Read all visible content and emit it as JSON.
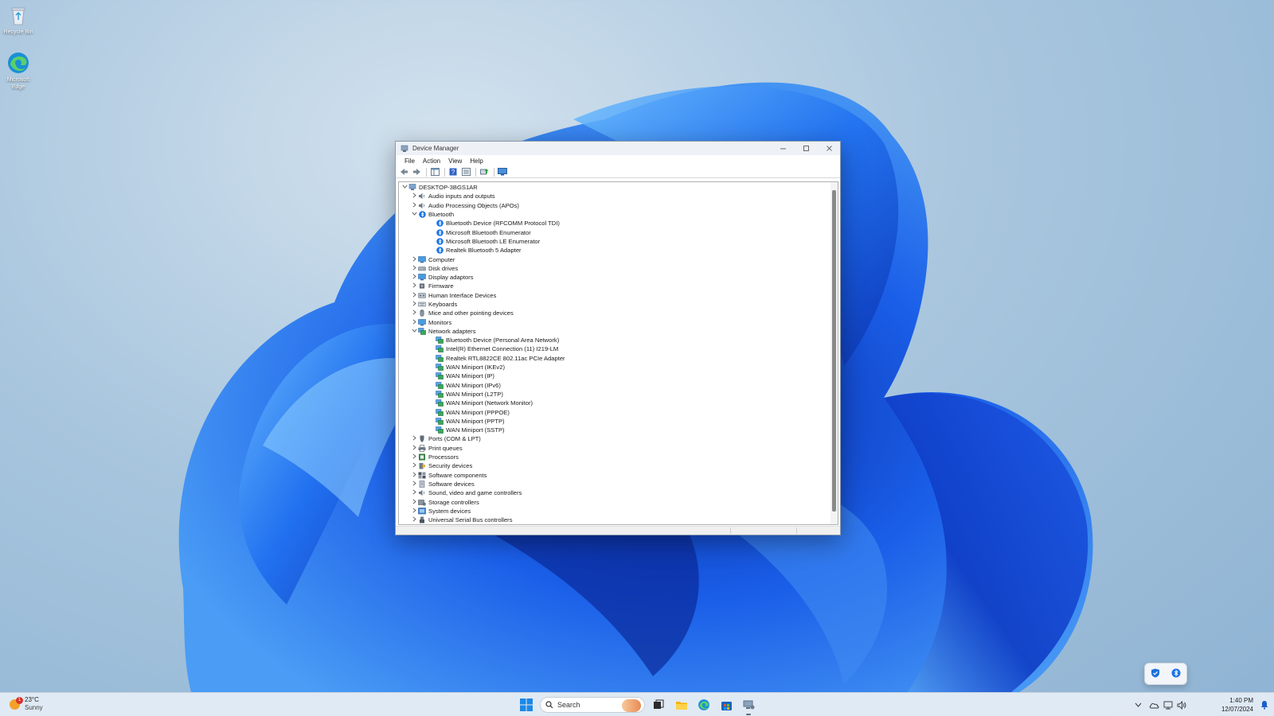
{
  "desktop": {
    "icons": [
      {
        "label": "Recycle Bin",
        "icon": "recycle-bin-icon"
      },
      {
        "label": "Microsoft Edge",
        "icon": "edge-icon"
      }
    ]
  },
  "window": {
    "title": "Device Manager",
    "menu": [
      "File",
      "Action",
      "View",
      "Help"
    ],
    "toolbar_icons": [
      "back-arrow-icon",
      "forward-arrow-icon",
      "show-hide-console-tree-icon",
      "help-icon",
      "properties-icon",
      "update-driver-icon",
      "scan-hardware-changes-icon"
    ],
    "tree": [
      {
        "level": 0,
        "expander": "v",
        "label": "DESKTOP-3BGS1AR",
        "icon": "computer-root-icon"
      },
      {
        "level": 1,
        "expander": ">",
        "label": "Audio inputs and outputs",
        "icon": "audio-icon"
      },
      {
        "level": 1,
        "expander": ">",
        "label": "Audio Processing Objects (APOs)",
        "icon": "audio-icon"
      },
      {
        "level": 1,
        "expander": "v",
        "label": "Bluetooth",
        "icon": "bluetooth-icon"
      },
      {
        "level": 2,
        "expander": "",
        "label": "Bluetooth Device (RFCOMM Protocol TDI)",
        "icon": "bluetooth-icon"
      },
      {
        "level": 2,
        "expander": "",
        "label": "Microsoft Bluetooth Enumerator",
        "icon": "bluetooth-icon"
      },
      {
        "level": 2,
        "expander": "",
        "label": "Microsoft Bluetooth LE Enumerator",
        "icon": "bluetooth-icon"
      },
      {
        "level": 2,
        "expander": "",
        "label": "Realtek Bluetooth 5 Adapter",
        "icon": "bluetooth-icon"
      },
      {
        "level": 1,
        "expander": ">",
        "label": "Computer",
        "icon": "monitor-icon"
      },
      {
        "level": 1,
        "expander": ">",
        "label": "Disk drives",
        "icon": "disk-icon"
      },
      {
        "level": 1,
        "expander": ">",
        "label": "Display adaptors",
        "icon": "monitor-icon"
      },
      {
        "level": 1,
        "expander": ">",
        "label": "Firmware",
        "icon": "chip-icon"
      },
      {
        "level": 1,
        "expander": ">",
        "label": "Human Interface Devices",
        "icon": "hid-icon"
      },
      {
        "level": 1,
        "expander": ">",
        "label": "Keyboards",
        "icon": "keyboard-icon"
      },
      {
        "level": 1,
        "expander": ">",
        "label": "Mice and other pointing devices",
        "icon": "mouse-icon"
      },
      {
        "level": 1,
        "expander": ">",
        "label": "Monitors",
        "icon": "monitor-icon"
      },
      {
        "level": 1,
        "expander": "v",
        "label": "Network adapters",
        "icon": "network-icon"
      },
      {
        "level": 2,
        "expander": "",
        "label": "Bluetooth Device (Personal Area Network)",
        "icon": "network-icon"
      },
      {
        "level": 2,
        "expander": "",
        "label": "Intel(R) Ethernet Connection (11) I219-LM",
        "icon": "network-icon"
      },
      {
        "level": 2,
        "expander": "",
        "label": "Realtek RTL8822CE 802.11ac PCIe Adapter",
        "icon": "network-icon"
      },
      {
        "level": 2,
        "expander": "",
        "label": "WAN Miniport (IKEv2)",
        "icon": "network-icon"
      },
      {
        "level": 2,
        "expander": "",
        "label": "WAN Miniport (IP)",
        "icon": "network-icon"
      },
      {
        "level": 2,
        "expander": "",
        "label": "WAN Miniport (IPv6)",
        "icon": "network-icon"
      },
      {
        "level": 2,
        "expander": "",
        "label": "WAN Miniport (L2TP)",
        "icon": "network-icon"
      },
      {
        "level": 2,
        "expander": "",
        "label": "WAN Miniport (Network Monitor)",
        "icon": "network-icon"
      },
      {
        "level": 2,
        "expander": "",
        "label": "WAN Miniport (PPPOE)",
        "icon": "network-icon"
      },
      {
        "level": 2,
        "expander": "",
        "label": "WAN Miniport (PPTP)",
        "icon": "network-icon"
      },
      {
        "level": 2,
        "expander": "",
        "label": "WAN Miniport (SSTP)",
        "icon": "network-icon"
      },
      {
        "level": 1,
        "expander": ">",
        "label": "Ports (COM & LPT)",
        "icon": "port-icon"
      },
      {
        "level": 1,
        "expander": ">",
        "label": "Print queues",
        "icon": "printer-icon"
      },
      {
        "level": 1,
        "expander": ">",
        "label": "Processors",
        "icon": "processor-icon"
      },
      {
        "level": 1,
        "expander": ">",
        "label": "Security devices",
        "icon": "security-icon"
      },
      {
        "level": 1,
        "expander": ">",
        "label": "Software components",
        "icon": "software-icon"
      },
      {
        "level": 1,
        "expander": ">",
        "label": "Software devices",
        "icon": "software-device-icon"
      },
      {
        "level": 1,
        "expander": ">",
        "label": "Sound, video and game controllers",
        "icon": "audio-icon"
      },
      {
        "level": 1,
        "expander": ">",
        "label": "Storage controllers",
        "icon": "storage-icon"
      },
      {
        "level": 1,
        "expander": ">",
        "label": "System devices",
        "icon": "system-icon"
      },
      {
        "level": 1,
        "expander": ">",
        "label": "Universal Serial Bus controllers",
        "icon": "usb-icon"
      }
    ]
  },
  "tray_popup": {
    "icons": [
      "windows-security-icon",
      "bluetooth-icon"
    ]
  },
  "taskbar": {
    "weather": {
      "temp": "23°C",
      "condition": "Sunny",
      "badge": "1"
    },
    "search_placeholder": "Search",
    "apps": [
      "task-view-icon",
      "file-explorer-icon",
      "edge-icon",
      "microsoft-store-icon",
      "device-manager-icon"
    ],
    "tray_icons": [
      "chevron-up-icon",
      "onedrive-icon",
      "network-icon",
      "volume-icon"
    ],
    "time": "1:40 PM",
    "date": "12/07/2024"
  },
  "colors": {
    "accent": "#0067c0",
    "bluetooth": "#1a73e8",
    "taskbar": "#e4ecf5"
  }
}
